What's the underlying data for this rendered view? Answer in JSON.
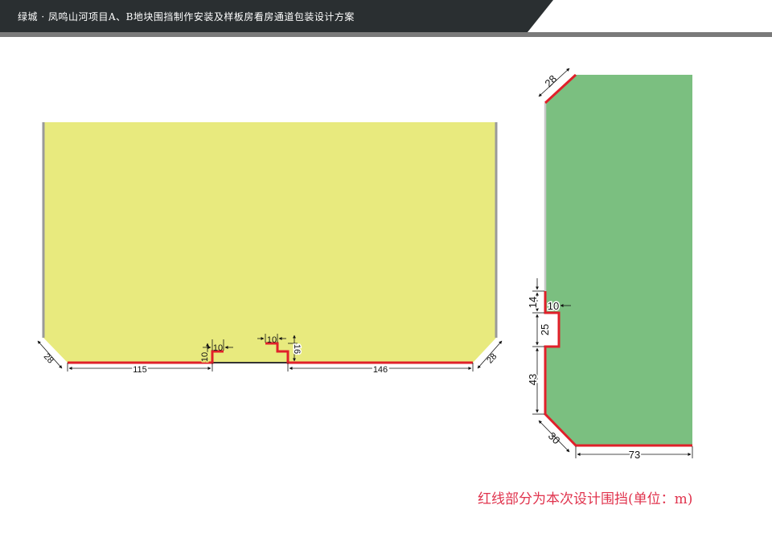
{
  "header": {
    "title": "绿城 · 凤鸣山河项目A、B地块围挡制作安装及样板房看房通道包装设计方案"
  },
  "colors": {
    "banner": "#2a2f31",
    "banner_stripe": "#7a7a7a",
    "yellow_area": "#e8ea7e",
    "green_area": "#7bbf80",
    "design_line": "#e0202a",
    "existing_line": "#9a9a9a"
  },
  "left_plan": {
    "dims": {
      "left_corner": "28",
      "right_corner": "28",
      "left_run": "115",
      "right_run": "146",
      "step1_width": "10",
      "step1_height": "10",
      "step2_width": "10",
      "step2_height": "16"
    }
  },
  "right_plan": {
    "dims": {
      "top_corner": "28",
      "seg1": "14",
      "notch_depth": "10",
      "seg2": "25",
      "seg3": "43",
      "bottom_corner": "30",
      "bottom_run": "73"
    }
  },
  "note": "红线部分为本次设计围挡(单位：m)"
}
